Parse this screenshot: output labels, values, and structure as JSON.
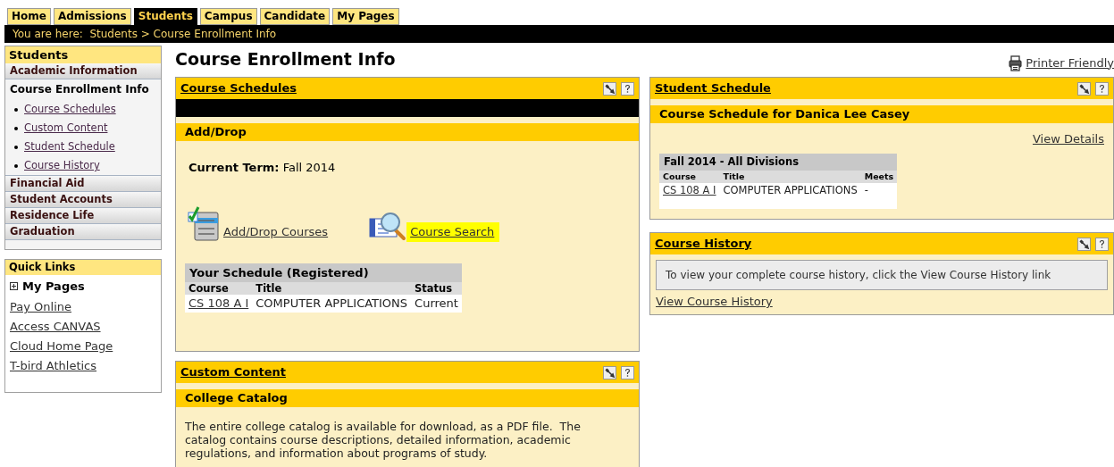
{
  "tabs": [
    {
      "label": "Home",
      "selected": false
    },
    {
      "label": "Admissions",
      "selected": false
    },
    {
      "label": "Students",
      "selected": true
    },
    {
      "label": "Campus",
      "selected": false
    },
    {
      "label": "Candidate",
      "selected": false
    },
    {
      "label": "My Pages",
      "selected": false
    }
  ],
  "breadcrumb": "You are here:  Students > Course Enrollment Info",
  "sidebar": {
    "title": "Students",
    "items": [
      {
        "label": "Academic Information",
        "kind": "group"
      },
      {
        "label": "Course Enrollment Info",
        "kind": "page",
        "children": [
          "Course Schedules",
          "Custom Content",
          "Student Schedule",
          "Course History"
        ]
      },
      {
        "label": "Financial Aid",
        "kind": "group"
      },
      {
        "label": "Student Accounts",
        "kind": "group"
      },
      {
        "label": "Residence Life",
        "kind": "group"
      },
      {
        "label": "Graduation",
        "kind": "group"
      }
    ]
  },
  "quick_links": {
    "title": "Quick Links",
    "expander": {
      "label": "My Pages",
      "expanded": false
    },
    "links": [
      "Pay Online",
      "Access CANVAS",
      "Cloud Home Page",
      "T-bird Athletics"
    ]
  },
  "page_title": "Course Enrollment Info",
  "printer_link": "Printer Friendly",
  "course_schedules": {
    "title": "Course Schedules",
    "subheader": "Add/Drop",
    "term_label": "Current Term:",
    "term": "Fall 2014",
    "actions": [
      {
        "label": "Add/Drop Courses",
        "kind": "add_drop",
        "highlighted": false
      },
      {
        "label": "Course Search",
        "kind": "search",
        "highlighted": true
      }
    ],
    "schedule": {
      "title": "Your Schedule (Registered)",
      "columns": [
        "Course",
        "Title",
        "Status"
      ],
      "rows": [
        [
          "CS 108 A I",
          "COMPUTER APPLICATIONS",
          "Current"
        ]
      ]
    }
  },
  "custom_content": {
    "title": "Custom Content",
    "subheader": "College Catalog",
    "text": "The entire college catalog is available for download, as a PDF file.  The catalog contains course descriptions, detailed information, academic regulations, and information about programs of study."
  },
  "student_schedule": {
    "title": "Student Schedule",
    "subheader": "Course Schedule for Danica Lee Casey",
    "details_link": "View Details",
    "table": {
      "title": "Fall 2014 - All Divisions",
      "columns": [
        "Course",
        "Title",
        "Meets"
      ],
      "rows": [
        [
          "CS 108 A I",
          "COMPUTER APPLICATIONS",
          "-"
        ]
      ]
    }
  },
  "course_history": {
    "title": "Course History",
    "notice": "To view your complete course history, click the View Course History link",
    "link": "View Course History"
  }
}
